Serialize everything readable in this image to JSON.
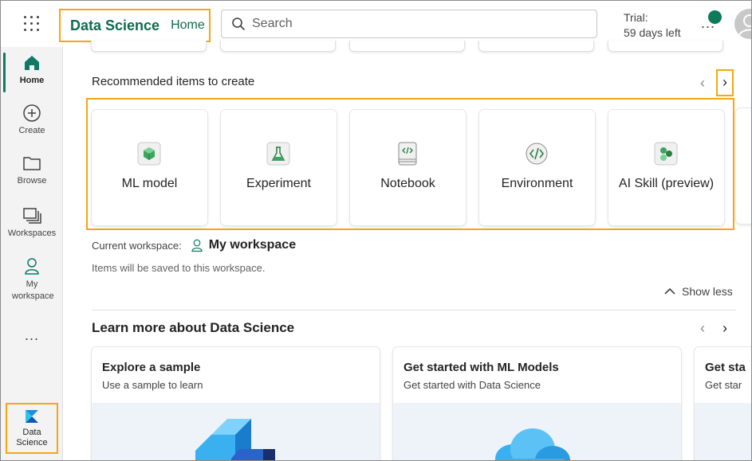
{
  "topbar": {
    "app_title": "Data Science",
    "home_link": "Home",
    "search_placeholder": "Search",
    "trial_label": "Trial:",
    "trial_days": "59 days left",
    "more_label": "..."
  },
  "rail": {
    "items": [
      {
        "label": "Home",
        "icon": "home-icon"
      },
      {
        "label": "Create",
        "icon": "plus-circle-icon"
      },
      {
        "label": "Browse",
        "icon": "folder-icon"
      },
      {
        "label": "Workspaces",
        "icon": "workspaces-icon"
      },
      {
        "label": "My workspace",
        "icon": "person-icon"
      }
    ],
    "more_label": "...",
    "experience_label": "Data Science"
  },
  "recommended": {
    "title": "Recommended items to create",
    "items": [
      {
        "label": "ML model",
        "icon": "ml-model-icon"
      },
      {
        "label": "Experiment",
        "icon": "experiment-icon"
      },
      {
        "label": "Notebook",
        "icon": "notebook-icon"
      },
      {
        "label": "Environment",
        "icon": "environment-icon"
      },
      {
        "label": "AI Skill (preview)",
        "icon": "ai-skill-icon"
      }
    ],
    "current_workspace_label": "Current workspace:",
    "workspace_name": "My workspace",
    "save_note": "Items will be saved to this workspace.",
    "show_less": "Show less"
  },
  "learn": {
    "title": "Learn more about Data Science",
    "cards": [
      {
        "title": "Explore a sample",
        "subtitle": "Use a sample to learn"
      },
      {
        "title": "Get started with ML Models",
        "subtitle": "Get started with Data Science"
      },
      {
        "title": "Get sta",
        "subtitle": "Get star"
      }
    ]
  },
  "colors": {
    "accent": "#0e6b4d",
    "highlight": "#f3a712",
    "rail_bg": "#f3f3f3"
  }
}
